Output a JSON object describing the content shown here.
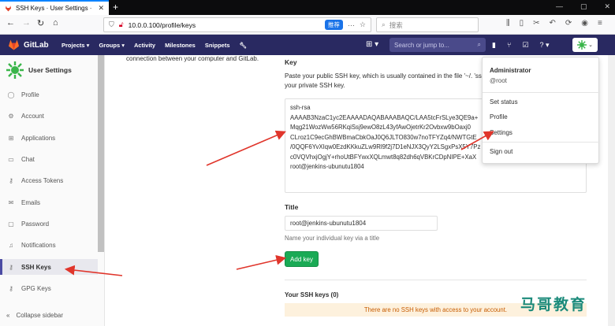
{
  "browser": {
    "tab_title": "SSH Keys · User Settings · Git",
    "url": "10.0.0.100/profile/keys",
    "translate_label": "推荐",
    "search_placeholder": "搜索"
  },
  "gitlab_nav": {
    "brand": "GitLab",
    "links": [
      "Projects ▾",
      "Groups ▾",
      "Activity",
      "Milestones",
      "Snippets"
    ],
    "search_placeholder": "Search or jump to...",
    "colors": {
      "navbar": "#292961",
      "accent": "#1aaa55"
    }
  },
  "sidebar": {
    "header": "User Settings",
    "items": [
      {
        "label": "Profile",
        "icon": "user-icon"
      },
      {
        "label": "Account",
        "icon": "gear-icon"
      },
      {
        "label": "Applications",
        "icon": "grid-icon"
      },
      {
        "label": "Chat",
        "icon": "chat-icon"
      },
      {
        "label": "Access Tokens",
        "icon": "key-icon"
      },
      {
        "label": "Emails",
        "icon": "mail-icon"
      },
      {
        "label": "Password",
        "icon": "lock-icon"
      },
      {
        "label": "Notifications",
        "icon": "bell-icon"
      },
      {
        "label": "SSH Keys",
        "icon": "key-icon"
      },
      {
        "label": "GPG Keys",
        "icon": "key-icon"
      }
    ],
    "collapse_label": "Collapse sidebar"
  },
  "main": {
    "intro": "connection between your computer and GitLab.",
    "key_label": "Key",
    "key_desc": "Paste your public SSH key, which is usually contained in the file '~/. 'ssh-rsa'. Don't use your private SSH key.",
    "key_value": "ssh-rsa\nAAAAB3NzaC1yc2EAAAADAQABAAABAQC/LAA5tcFrSLye3QE9a+\nMqg21WozWw56RKqiSsj9ewO8zL43yfAwOjetrKr2Ovbxw9bOaxj0\nCLroz1C9ecGhBWBmaCbkOaJ0Q6JLTO830w7noTFYZq4/NWTGtE\n/0QQF6YvXIqw0EzdKKkuZLw9Rl9f2j7D1eNJX3QyY2LSgxPsX5Y7Pz\nc0VQVhxjOgjY+rhoUtBFYwxXQLmwt8q82dh6qVBKrCDpNIPE+XaX\nroot@jenkins-ubunutu1804",
    "title_label": "Title",
    "title_value": "root@jenkins-ubunutu1804",
    "title_hint": "Name your individual key via a title",
    "add_button": "Add key",
    "your_keys": "Your SSH keys (0)",
    "no_keys": "There are no SSH keys with access to your account."
  },
  "user_menu": {
    "name": "Administrator",
    "username": "@root",
    "items": [
      "Set status",
      "Profile",
      "Settings"
    ],
    "sign_out": "Sign out"
  },
  "watermark": "马哥教育"
}
